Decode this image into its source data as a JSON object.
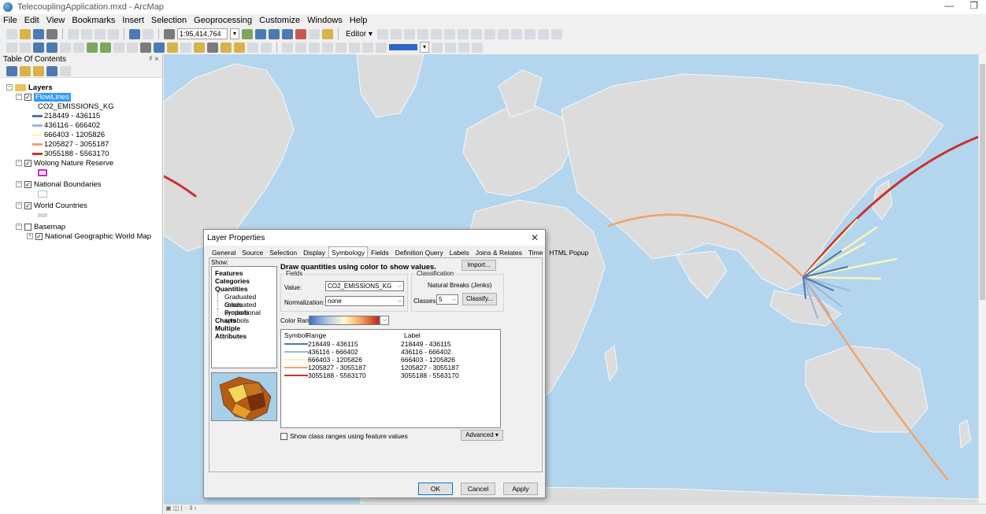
{
  "window": {
    "title": "TelecouplingApplication.mxd - ArcMap",
    "min": "—",
    "restore": "❐"
  },
  "menu": [
    "File",
    "Edit",
    "View",
    "Bookmarks",
    "Insert",
    "Selection",
    "Geoprocessing",
    "Customize",
    "Windows",
    "Help"
  ],
  "toolbar": {
    "scale": "1:95,414,764",
    "editor_label": "Editor ▾"
  },
  "toc": {
    "title": "Table Of Contents",
    "pin": "ᵖ ×",
    "root_label": "Layers",
    "flowlines": {
      "label": "FlowLines",
      "field": "CO2_EMISSIONS_KG"
    },
    "classes": [
      {
        "label": "218449 - 436115",
        "color": "#4a74b4"
      },
      {
        "label": "436116 - 666402",
        "color": "#9fb6d8"
      },
      {
        "label": "666403 - 1205826",
        "color": "#fbf6b9"
      },
      {
        "label": "1205827 - 3055187",
        "color": "#f0a36a"
      },
      {
        "label": "3055188 - 5563170",
        "color": "#cc3030"
      }
    ],
    "wolong": "Wolong Nature Reserve",
    "national_boundaries": "National Boundaries",
    "world_countries": "World Countries",
    "basemap": "Basemap",
    "natgeo": "National Geographic World Map"
  },
  "dialog": {
    "title": "Layer Properties",
    "close": "✕",
    "tabs": [
      "General",
      "Source",
      "Selection",
      "Display",
      "Symbology",
      "Fields",
      "Definition Query",
      "Labels",
      "Joins & Relates",
      "Time",
      "HTML Popup"
    ],
    "show_label": "Show:",
    "show_items": {
      "features": "Features",
      "categories": "Categories",
      "quantities": "Quantities",
      "graduated_colors": "Graduated colors",
      "graduated_symbols": "Graduated symbols",
      "proportional_symbols": "Proportional symbols",
      "charts": "Charts",
      "multiple_attributes": "Multiple Attributes"
    },
    "heading": "Draw quantities using color to show values.",
    "import": "Import...",
    "fields_group": "Fields",
    "value_label": "Value:",
    "value": "CO2_EMISSIONS_KG",
    "normalization_label": "Normalization:",
    "normalization": "none",
    "classification_group": "Classification",
    "method": "Natural Breaks (Jenks)",
    "classes_label": "Classes:",
    "classes": "5",
    "classify": "Classify...",
    "color_ramp_label": "Color Ramp:",
    "grid_headers": {
      "symbol": "Symbol",
      "range": "Range",
      "label": "Label"
    },
    "rows": [
      {
        "range": "218449 - 436115",
        "label": "218449 - 436115",
        "color": "#4a74b4"
      },
      {
        "range": "436116 - 666402",
        "label": "436116 - 666402",
        "color": "#9fb6d8"
      },
      {
        "range": "666403 - 1205826",
        "label": "666403 - 1205826",
        "color": "#fbf6b9"
      },
      {
        "range": "1205827 - 3055187",
        "label": "1205827 - 3055187",
        "color": "#f0a36a"
      },
      {
        "range": "3055188 - 5563170",
        "label": "3055188 - 5563170",
        "color": "#cc3030"
      }
    ],
    "show_ranges": "Show class ranges using feature values",
    "advanced": "Advanced ▾",
    "ok": "OK",
    "cancel": "Cancel",
    "apply": "Apply"
  },
  "status": "▣ ◫ | ◌ ll ‹"
}
